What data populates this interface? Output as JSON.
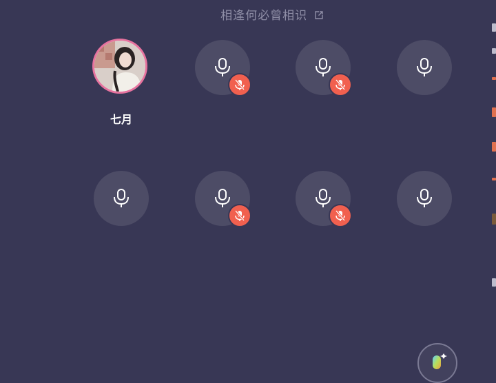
{
  "room": {
    "title": "相逢何必曾相识"
  },
  "seats": [
    {
      "name": "七月",
      "type": "host"
    },
    {
      "type": "empty",
      "muted": true
    },
    {
      "type": "empty",
      "muted": true
    },
    {
      "type": "empty",
      "muted": false
    },
    {
      "type": "empty",
      "muted": false
    },
    {
      "type": "empty",
      "muted": true
    },
    {
      "type": "empty",
      "muted": true
    },
    {
      "type": "empty",
      "muted": false
    }
  ],
  "icons": {
    "seat_mic": "microphone-icon",
    "mute": "mic-off-icon",
    "external_link": "external-link-icon",
    "voice": "voice-mic-icon"
  },
  "colors": {
    "background": "#383755",
    "seat": "#4d4c66",
    "mute_badge": "#f1604f",
    "host_ring": "#e7739f"
  }
}
